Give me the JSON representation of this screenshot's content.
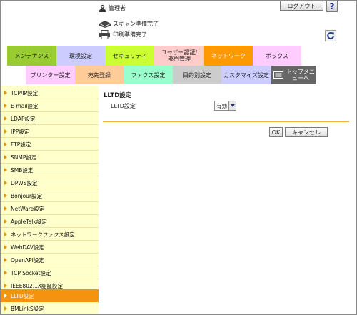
{
  "header": {
    "user": {
      "icon": "admin-user-icon",
      "name": "管理者"
    },
    "logout_label": "ログアウト",
    "help_label": "?",
    "status": [
      {
        "icon": "scanner-icon",
        "text": "スキャン準備完了"
      },
      {
        "icon": "printer-icon",
        "text": "印刷準備完了"
      }
    ],
    "refresh_icon": "refresh-icon"
  },
  "main_tabs": [
    {
      "label": "メンテナンス",
      "color": "#99cc33",
      "active": false
    },
    {
      "label": "環境設定",
      "color": "#ccccff",
      "active": false
    },
    {
      "label": "セキュリティ",
      "color": "#ccff33",
      "active": false
    },
    {
      "label": "ユーザー認証/部門管理",
      "color": "#ffcccc",
      "active": false
    },
    {
      "label": "ネットワーク",
      "color": "#ff9900",
      "active": true
    },
    {
      "label": "ボックス",
      "color": "#ffccff",
      "active": false
    }
  ],
  "sub_tabs": [
    {
      "label": "プリンター設定",
      "color": "#ffccff"
    },
    {
      "label": "宛先登録",
      "color": "#ffcc99"
    },
    {
      "label": "ファクス設定",
      "color": "#99ffcc"
    },
    {
      "label": "目的別設定",
      "color": "#cccccc"
    },
    {
      "label": "カスタマイズ設定",
      "color": "#ccccff"
    },
    {
      "label": "トップメニューへ",
      "color": "#666666",
      "icon": "top-menu-icon"
    }
  ],
  "sidebar": {
    "items": [
      {
        "label": "TCP/IP設定",
        "active": false
      },
      {
        "label": "E-mail設定",
        "active": false
      },
      {
        "label": "LDAP設定",
        "active": false
      },
      {
        "label": "IPP設定",
        "active": false
      },
      {
        "label": "FTP設定",
        "active": false
      },
      {
        "label": "SNMP設定",
        "active": false
      },
      {
        "label": "SMB設定",
        "active": false
      },
      {
        "label": "DPWS設定",
        "active": false
      },
      {
        "label": "Bonjour設定",
        "active": false
      },
      {
        "label": "NetWare設定",
        "active": false
      },
      {
        "label": "AppleTalk設定",
        "active": false
      },
      {
        "label": "ネットワークファクス設定",
        "active": false
      },
      {
        "label": "WebDAV設定",
        "active": false
      },
      {
        "label": "OpenAPI設定",
        "active": false
      },
      {
        "label": "TCP Socket設定",
        "active": false
      },
      {
        "label": "IEEE802.1X認証設定",
        "active": false
      },
      {
        "label": "LLTD設定",
        "active": true
      },
      {
        "label": "BMLinkS設定",
        "active": false
      }
    ]
  },
  "content": {
    "title": "LLTD設定",
    "field_label": "LLTD設定",
    "field_value": "有効",
    "ok_label": "OK",
    "cancel_label": "キャンセル"
  },
  "colors": {
    "accent": "#f5930f",
    "sidebar_bg": "#ffffcc",
    "divider": "#f5b04a"
  }
}
